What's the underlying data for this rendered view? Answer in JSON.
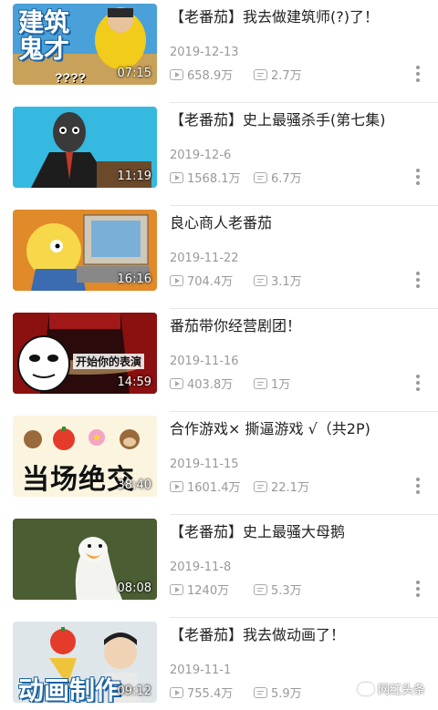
{
  "videos": [
    {
      "title": "【老番茄】我去做建筑师(?)了！",
      "date": "2019-12-13",
      "views": "658.9万",
      "danmaku": "2.7万",
      "duration": "07:15",
      "thumb_caption_1": "建筑",
      "thumb_caption_2": "鬼才",
      "thumb_caption_3": "????"
    },
    {
      "title": "【老番茄】史上最骚杀手(第七集)",
      "date": "2019-12-6",
      "views": "1568.1万",
      "danmaku": "6.7万",
      "duration": "11:19"
    },
    {
      "title": "良心商人老番茄",
      "date": "2019-11-22",
      "views": "704.4万",
      "danmaku": "3.1万",
      "duration": "16:16"
    },
    {
      "title": "番茄带你经营剧团！",
      "date": "2019-11-16",
      "views": "403.8万",
      "danmaku": "1万",
      "duration": "14:59",
      "thumb_caption": "开始你的表演"
    },
    {
      "title": "合作游戏× 撕逼游戏 √（共2P)",
      "date": "2019-11-15",
      "views": "1601.4万",
      "danmaku": "22.1万",
      "duration": "38:40",
      "thumb_caption": "当场绝交"
    },
    {
      "title": "【老番茄】史上最骚大母鹅",
      "date": "2019-11-8",
      "views": "1240万",
      "danmaku": "5.3万",
      "duration": "08:08"
    },
    {
      "title": "【老番茄】我去做动画了！",
      "date": "2019-11-1",
      "views": "755.4万",
      "danmaku": "5.9万",
      "duration": "09:12",
      "thumb_caption": "动画制作"
    }
  ],
  "watermark": "网红头条",
  "colors": {
    "text": "#222222",
    "meta": "#999999",
    "divider": "#e6e6e6",
    "accent_blue": "#1b62a0"
  }
}
